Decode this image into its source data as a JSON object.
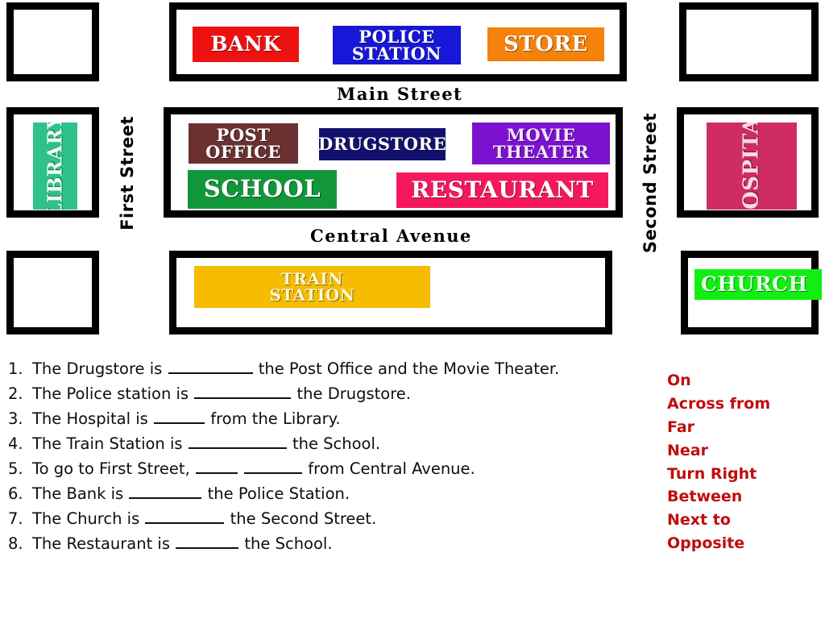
{
  "map": {
    "streets": {
      "horizontal": [
        {
          "name": "Main Street"
        },
        {
          "name": "Central Avenue"
        }
      ],
      "vertical": [
        {
          "name": "First Street"
        },
        {
          "name": "Second Street"
        }
      ]
    },
    "buildings": [
      {
        "name": "BANK",
        "color": "#ee1111",
        "text_color": "#ffffff"
      },
      {
        "name": "POLICE\nSTATION",
        "color": "#1717d8",
        "text_color": "#ffffff"
      },
      {
        "name": "STORE",
        "color": "#f5820b",
        "text_color": "#ffffff"
      },
      {
        "name": "LIBRARY",
        "color": "#2ec18a",
        "text_color": "#eafff6"
      },
      {
        "name": "POST\nOFFICE",
        "color": "#6b3030",
        "text_color": "#ffffff"
      },
      {
        "name": "DRUGSTORE",
        "color": "#13116e",
        "text_color": "#ffffff"
      },
      {
        "name": "MOVIE\nTHEATER",
        "color": "#7a12cf",
        "text_color": "#f6e3ff"
      },
      {
        "name": "SCHOOL",
        "color": "#12963a",
        "text_color": "#ffffff"
      },
      {
        "name": "RESTAURANT",
        "color": "#f5185f",
        "text_color": "#ffffff"
      },
      {
        "name": "HOSPITAL",
        "color": "#cf2b64",
        "text_color": "#ffd9e6"
      },
      {
        "name": "TRAIN\nSTATION",
        "color": "#f5bc00",
        "text_color": "#fff7d6"
      },
      {
        "name": "CHURCH",
        "color": "#12ee12",
        "text_color": "#e8ffe8"
      }
    ]
  },
  "exercise": {
    "questions": [
      {
        "num": "1.",
        "parts": [
          "The Drugstore is ",
          "BLANK:105",
          " the Post Office and the Movie Theater."
        ]
      },
      {
        "num": "2.",
        "parts": [
          "The Police station is ",
          "BLANK:120",
          " the Drugstore."
        ]
      },
      {
        "num": "3.",
        "parts": [
          "The Hospital is ",
          "BLANK:63",
          " from the Library."
        ]
      },
      {
        "num": "4.",
        "parts": [
          "The Train Station is ",
          "BLANK:122",
          " the School."
        ]
      },
      {
        "num": "5.",
        "parts": [
          "To go to First Street, ",
          "BLANK:52",
          " ",
          "BLANK:72",
          " from Central Avenue."
        ]
      },
      {
        "num": "6.",
        "parts": [
          "The Bank is ",
          "BLANK:90",
          " the Police Station."
        ]
      },
      {
        "num": "7.",
        "parts": [
          "The Church is ",
          "BLANK:98",
          " the Second Street."
        ]
      },
      {
        "num": "8.",
        "parts": [
          "The Restaurant is ",
          "BLANK:78",
          " the School."
        ]
      }
    ]
  },
  "word_bank": {
    "accent_color": "#c00d0d",
    "words": [
      "On",
      "Across from",
      "Far",
      "Near",
      "Turn Right",
      "Between",
      "Next to",
      "Opposite"
    ]
  }
}
